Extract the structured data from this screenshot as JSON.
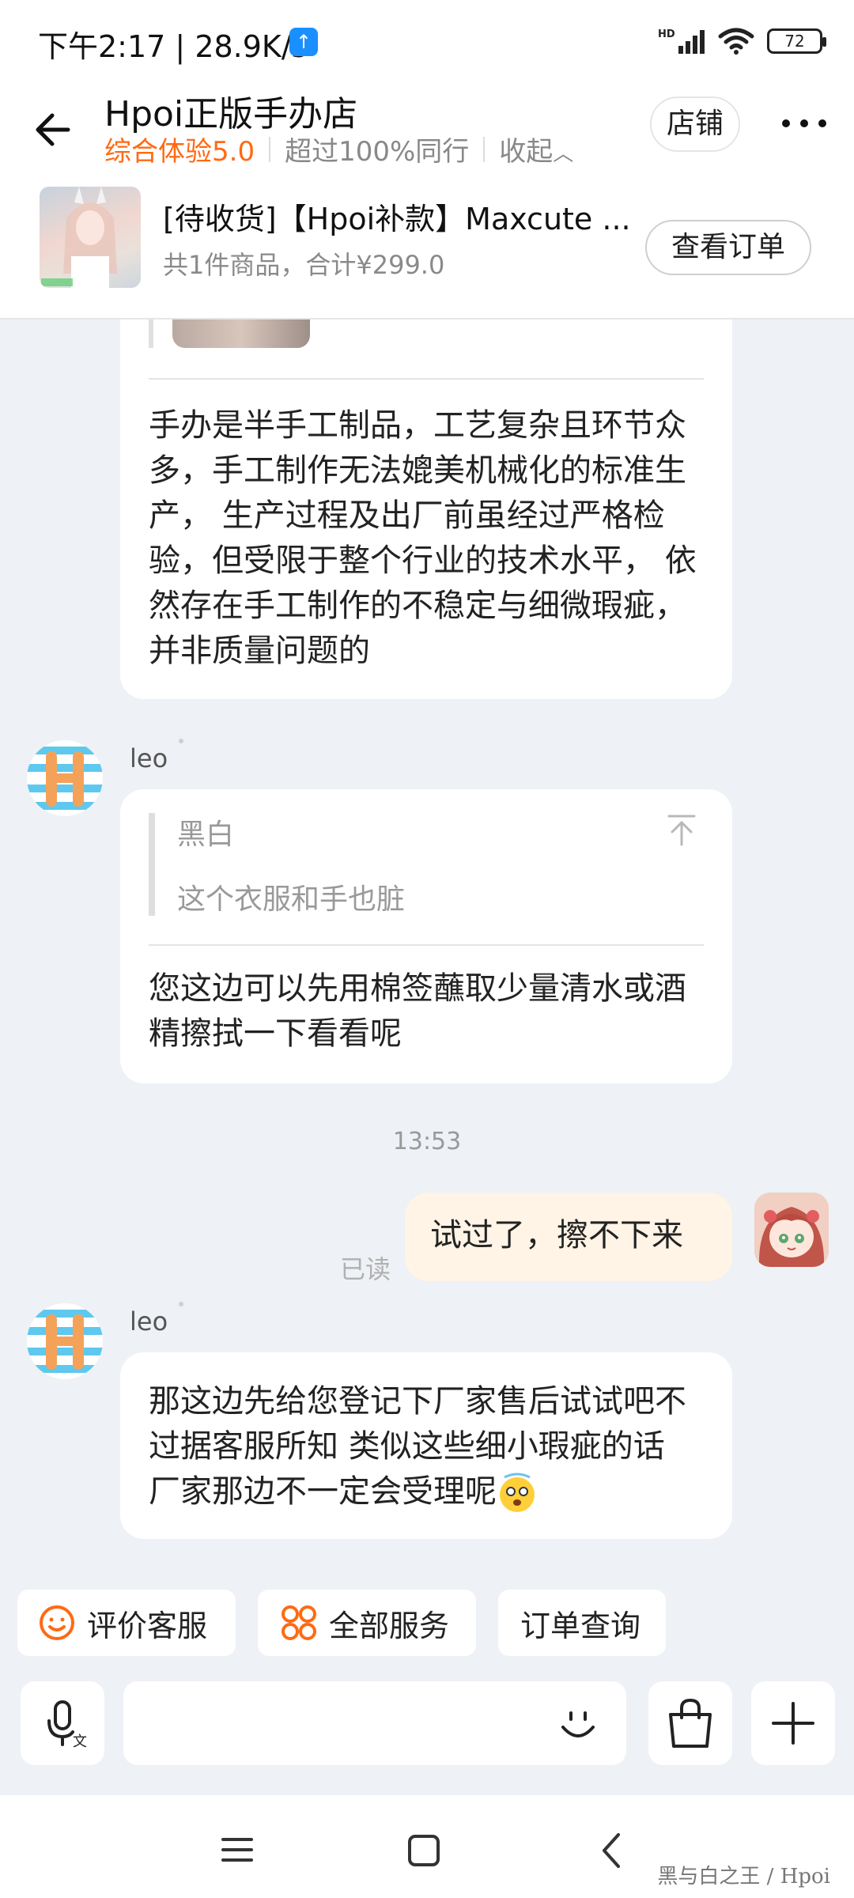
{
  "status_bar": {
    "time": "下午2:17",
    "net_speed": "28.9K/s",
    "signal_label": "HD",
    "battery": "72"
  },
  "header": {
    "shop_name": "Hpoi正版手办店",
    "score": "综合体验5.0",
    "rank": "超过100%同行",
    "collapse": "收起",
    "shop_button": "店铺"
  },
  "order": {
    "title": "[待收货]【Hpoi补款】Maxcute ...",
    "subtitle": "共1件商品，合计¥299.0",
    "button": "查看订单"
  },
  "messages": {
    "m1_text": "手办是半手工制品，工艺复杂且环节众多，手工制作无法媲美机械化的标准生产， 生产过程及出厂前虽经过严格检验，但受限于整个行业的技术水平， 依然存在手工制作的不稳定与细微瑕疵，并非质量问题的",
    "m2_sender": "leo",
    "m2_quote_name": "黑白",
    "m2_quote_text": "这个衣服和手也脏",
    "m2_text": "您这边可以先用棉签蘸取少量清水或酒精擦拭一下看看呢",
    "timestamp": "13:53",
    "m3_text": "试过了，擦不下来",
    "m3_status": "已读",
    "m4_sender": "leo",
    "m4_text": "那这边先给您登记下厂家售后试试吧不过据客服所知 类似这些细小瑕疵的话 厂家那边不一定会受理呢"
  },
  "quick_actions": [
    "评价客服",
    "全部服务",
    "订单查询"
  ],
  "watermark": "黑与白之王 / Hpoi",
  "colors": {
    "accent_orange": "#ff6a13",
    "my_bubble": "#fff4e6",
    "background": "#eef1f5",
    "logo_blue": "#5ec8ee",
    "logo_orange": "#f4a259"
  }
}
